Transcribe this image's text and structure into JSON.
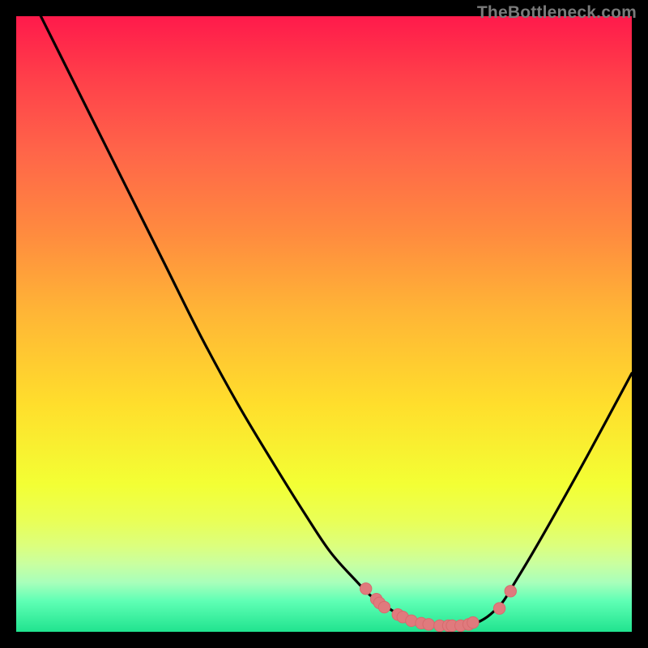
{
  "watermark": {
    "text": "TheBottleneck.com"
  },
  "chart_data": {
    "type": "line",
    "title": "",
    "xlabel": "",
    "ylabel": "",
    "xlim": [
      0,
      100
    ],
    "ylim": [
      0,
      100
    ],
    "grid": false,
    "series": [
      {
        "name": "bottleneck-curve",
        "x": [
          0,
          6,
          12,
          18,
          24,
          30,
          36,
          42,
          47,
          51,
          55,
          58,
          61,
          63,
          65,
          67,
          70,
          72,
          74,
          75.5,
          77,
          79,
          81,
          84,
          88,
          93,
          100
        ],
        "y": [
          108,
          96,
          84,
          72,
          60,
          48,
          37,
          27,
          19,
          13,
          8.5,
          5.5,
          3.5,
          2.3,
          1.6,
          1.2,
          1.0,
          1.0,
          1.2,
          1.8,
          2.8,
          4.8,
          8.0,
          13,
          20,
          29,
          42
        ]
      }
    ],
    "scatter": [
      {
        "name": "data-points",
        "x": [
          56.8,
          58.5,
          59.0,
          59.8,
          62.0,
          62.8,
          64.2,
          65.8,
          67.0,
          68.8,
          70.2,
          70.8,
          72.2,
          73.5,
          74.2,
          78.5,
          80.3
        ],
        "y": [
          7.0,
          5.3,
          4.7,
          4.0,
          2.8,
          2.4,
          1.8,
          1.4,
          1.2,
          1.0,
          1.0,
          1.0,
          1.0,
          1.2,
          1.5,
          3.8,
          6.6
        ]
      }
    ],
    "background": {
      "type": "vertical-gradient",
      "stops": [
        {
          "pos": 0.0,
          "color": "#ff1a4b"
        },
        {
          "pos": 0.1,
          "color": "#ff3f4a"
        },
        {
          "pos": 0.22,
          "color": "#ff6549"
        },
        {
          "pos": 0.35,
          "color": "#ff8a3f"
        },
        {
          "pos": 0.48,
          "color": "#ffb536"
        },
        {
          "pos": 0.63,
          "color": "#ffde2c"
        },
        {
          "pos": 0.76,
          "color": "#f3ff34"
        },
        {
          "pos": 0.82,
          "color": "#e9ff57"
        },
        {
          "pos": 0.86,
          "color": "#dcff7d"
        },
        {
          "pos": 0.89,
          "color": "#c9ffa0"
        },
        {
          "pos": 0.92,
          "color": "#a8ffbb"
        },
        {
          "pos": 0.95,
          "color": "#5fffb5"
        },
        {
          "pos": 1.0,
          "color": "#20e38f"
        }
      ]
    }
  }
}
